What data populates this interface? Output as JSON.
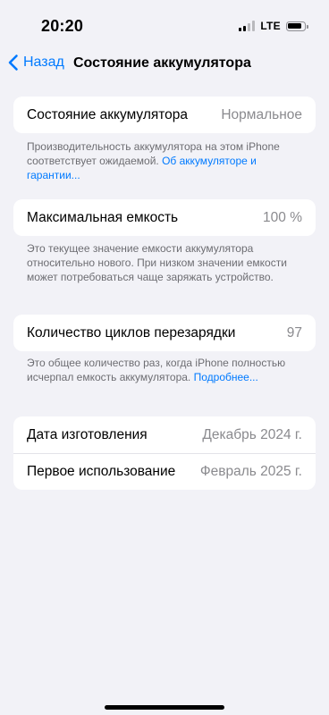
{
  "status_bar": {
    "time": "20:20",
    "network": "LTE",
    "signal_bars_active": 2,
    "battery_level_fraction": 0.85
  },
  "nav": {
    "back_label": "Назад",
    "title": "Состояние аккумулятора"
  },
  "battery_condition": {
    "label": "Состояние аккумулятора",
    "value": "Нормальное",
    "footer_text": "Производительность аккумулятора на этом iPhone соответствует ожидаемой. ",
    "footer_link": "Об аккумуляторе и гарантии..."
  },
  "max_capacity": {
    "label": "Максимальная емкость",
    "value": "100 %",
    "footer_text": "Это текущее значение емкости аккумулятора относительно нового. При низком значении емкости может потребоваться чаще заряжать устройство."
  },
  "cycle_count": {
    "label": "Количество циклов перезарядки",
    "value": "97",
    "footer_text": "Это общее количество раз, когда iPhone полностью исчерпал емкость аккумулятора.",
    "footer_link": "Подробнее..."
  },
  "dates": {
    "manufacture_label": "Дата изготовления",
    "manufacture_value": "Декабрь 2024 г.",
    "first_use_label": "Первое использование",
    "first_use_value": "Февраль 2025 г."
  },
  "colors": {
    "accent": "#007aff",
    "background": "#f2f2f7",
    "secondary_text": "#8a8a8e"
  }
}
